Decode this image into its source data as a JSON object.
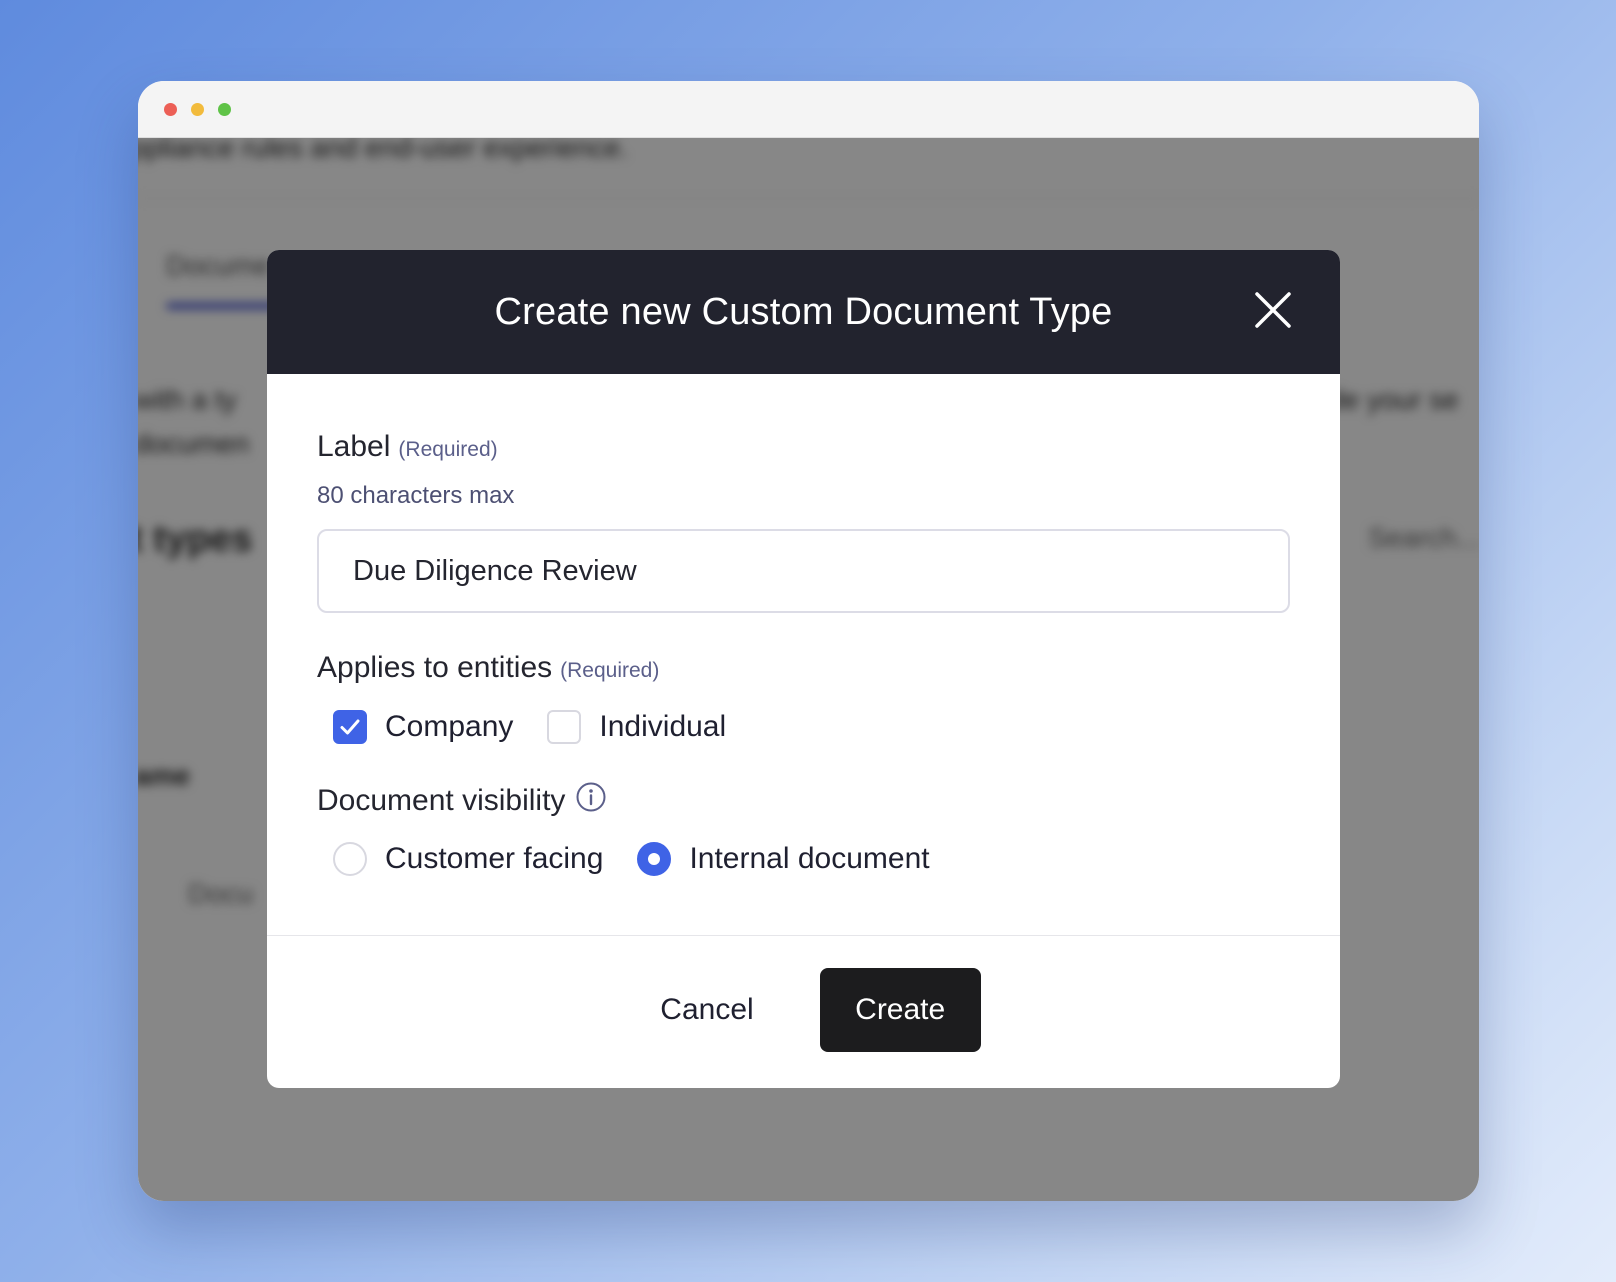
{
  "background_page": {
    "subtitle_fragment": "ppliance rules and end-user experience.",
    "tab_fragment": "Docume",
    "body_fragment_left_1": "with a ty",
    "body_fragment_left_2": "documen",
    "body_fragment_right": "de your se",
    "section_fragment": "t types",
    "search_placeholder": "Search...",
    "column_fragment": "ame",
    "row_fragment": "Docu"
  },
  "modal": {
    "title": "Create new Custom Document Type",
    "label_field": {
      "label": "Label",
      "required": "(Required)",
      "hint": "80 characters max",
      "value": "Due Diligence Review"
    },
    "entities": {
      "label": "Applies to entities",
      "required": "(Required)",
      "options": [
        {
          "label": "Company",
          "checked": true
        },
        {
          "label": "Individual",
          "checked": false
        }
      ]
    },
    "visibility": {
      "label": "Document visibility",
      "info_icon": "info-icon",
      "options": [
        {
          "label": "Customer facing",
          "selected": false
        },
        {
          "label": "Internal document",
          "selected": true
        }
      ]
    },
    "footer": {
      "cancel_label": "Cancel",
      "create_label": "Create"
    }
  },
  "colors": {
    "accent": "#3f63e6",
    "header_bg": "#22232e",
    "create_bg": "#1c1c1e"
  }
}
